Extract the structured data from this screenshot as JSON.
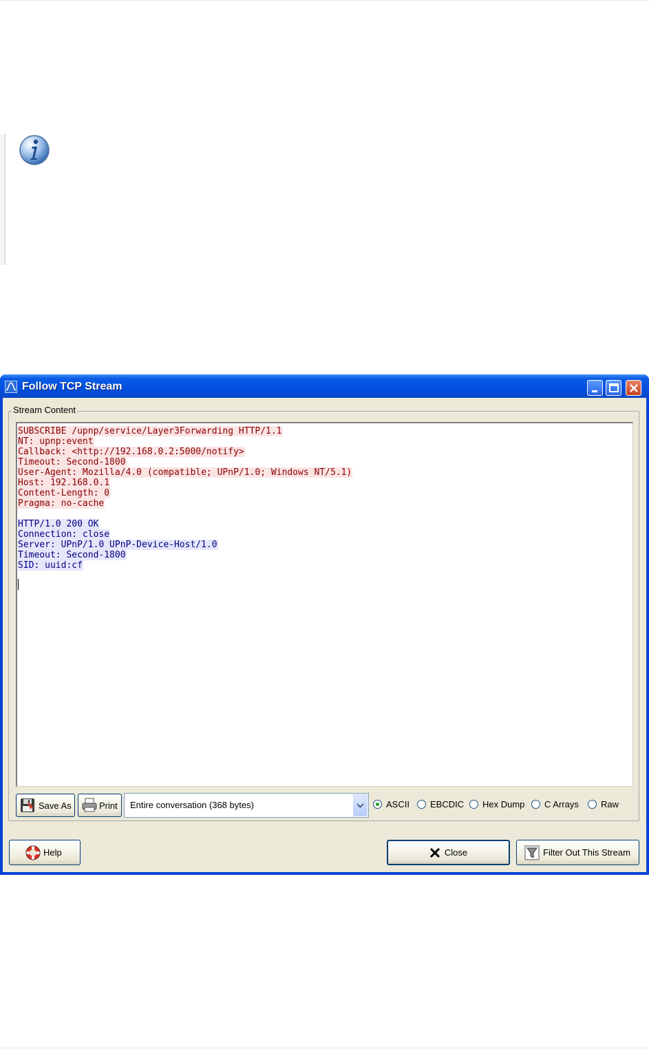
{
  "window": {
    "title": "Follow TCP Stream"
  },
  "stream": {
    "group_label": "Stream Content",
    "client_lines": [
      "SUBSCRIBE /upnp/service/Layer3Forwarding HTTP/1.1",
      "NT: upnp:event",
      "Callback: <http://192.168.0.2:5000/notify>",
      "Timeout: Second-1800",
      "User-Agent: Mozilla/4.0 (compatible; UPnP/1.0; Windows NT/5.1)",
      "Host: 192.168.0.1",
      "Content-Length: 0",
      "Pragma: no-cache"
    ],
    "server_lines": [
      "HTTP/1.0 200 OK",
      "Connection: close",
      "Server: UPnP/1.0 UPnP-Device-Host/1.0",
      "Timeout: Second-1800",
      "SID: uuid:cf"
    ],
    "colors": {
      "client_bg": "#fbe4e4",
      "client_fg": "#8b0000",
      "server_bg": "#e6e6fb",
      "server_fg": "#000080"
    }
  },
  "toolbar": {
    "save_as_label": "Save As",
    "print_label": "Print",
    "conversation_select": "Entire conversation (368 bytes)",
    "format_options": [
      {
        "label": "ASCII",
        "selected": true
      },
      {
        "label": "EBCDIC",
        "selected": false
      },
      {
        "label": "Hex Dump",
        "selected": false
      },
      {
        "label": "C Arrays",
        "selected": false
      },
      {
        "label": "Raw",
        "selected": false
      }
    ]
  },
  "footer": {
    "help_label": "Help",
    "close_label": "Close",
    "filter_label": "Filter Out This Stream"
  }
}
